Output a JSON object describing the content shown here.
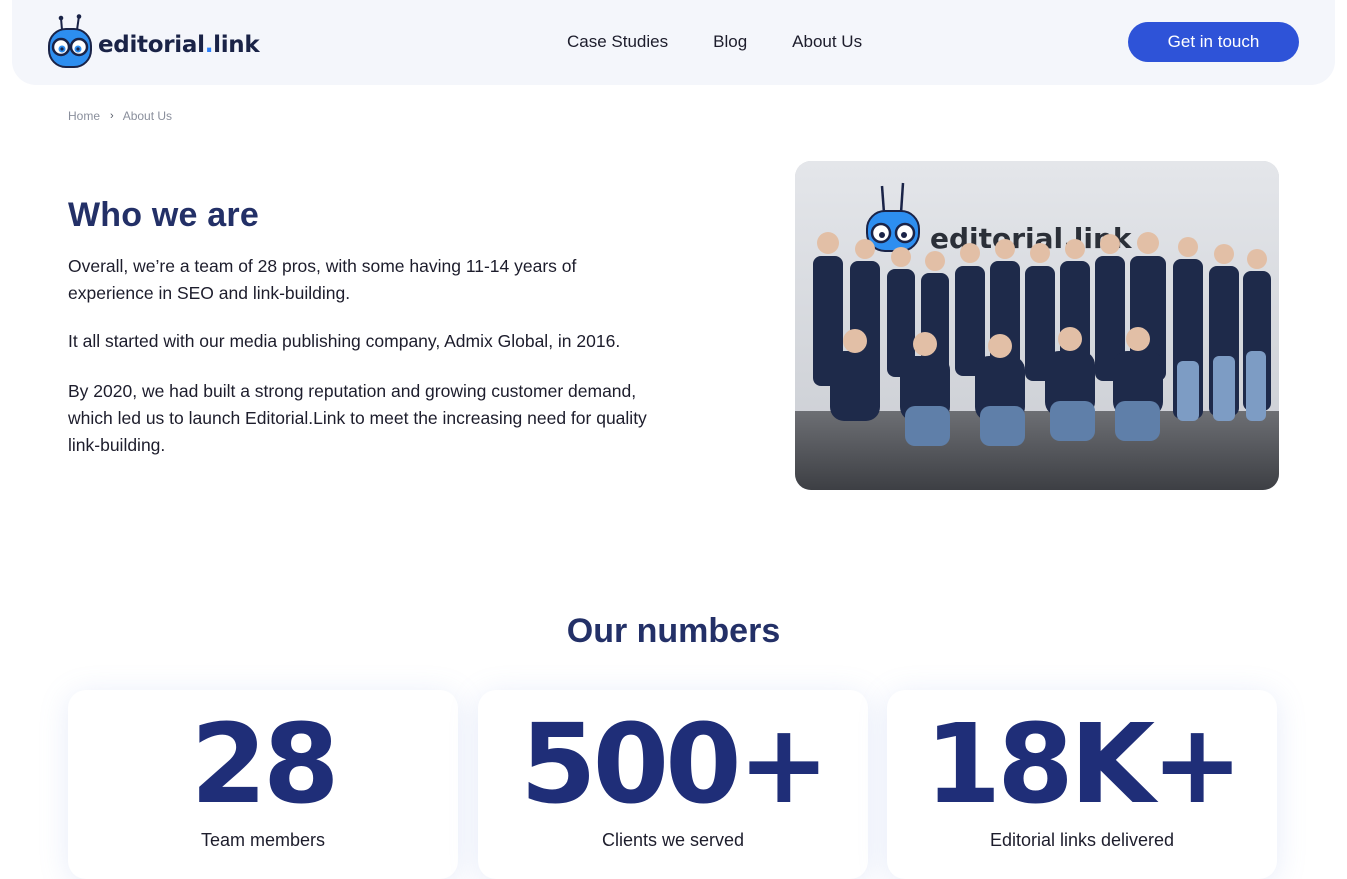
{
  "header": {
    "logo": {
      "name": "editorial",
      "dot": ".",
      "tld": "link",
      "mascot_icon": "robot-mascot-icon"
    },
    "nav": [
      {
        "label": "Case Studies"
      },
      {
        "label": "Blog"
      },
      {
        "label": "About Us"
      }
    ],
    "cta_label": "Get in touch"
  },
  "breadcrumb": {
    "home": "Home",
    "separator_icon": "chevron-right-icon",
    "separator": "›",
    "current": "About Us"
  },
  "who": {
    "title": "Who we are",
    "paragraphs": [
      "Overall, we’re a team of 28 pros, with some having 11-14 years of experience in SEO and link-building.",
      "It all started with our media publishing company, Admix Global, in 2016.",
      "By 2020, we had built a strong reputation and growing customer demand, which led us to launch Editorial.Link to meet the increasing need for quality link-building."
    ],
    "photo": {
      "wall_text": "editorial.link"
    }
  },
  "numbers": {
    "title": "Our numbers",
    "stats": [
      {
        "value": "28",
        "label": "Team members"
      },
      {
        "value": "500+",
        "label": "Clients we served"
      },
      {
        "value": "18K+",
        "label": "Editorial links delivered"
      }
    ]
  },
  "colors": {
    "brand_navy": "#233067",
    "stat_navy": "#1f2e78",
    "cta_blue": "#2e53d8",
    "header_bg": "#f4f6fb",
    "accent_dot": "#2d7ff9"
  }
}
